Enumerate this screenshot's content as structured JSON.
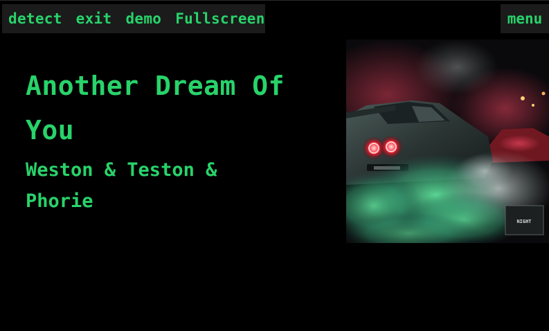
{
  "toolbar": {
    "buttons": [
      {
        "name": "detect-button",
        "label": "detect"
      },
      {
        "name": "exit-button",
        "label": "exit"
      },
      {
        "name": "demo-button",
        "label": "demo"
      },
      {
        "name": "fullscreen-button",
        "label": "Fullscreen"
      }
    ],
    "menu_label": "menu"
  },
  "now_playing": {
    "title": "Another Dream Of You",
    "artist": "Weston & Teston & Phorie"
  },
  "cover_art": {
    "icon": "album-cover-street-racing-car-smoke",
    "badge_text": "NIGHT"
  },
  "colors": {
    "background": "#000000",
    "accent_text": "#28d36a",
    "button_bg": "#1b1b1b"
  }
}
